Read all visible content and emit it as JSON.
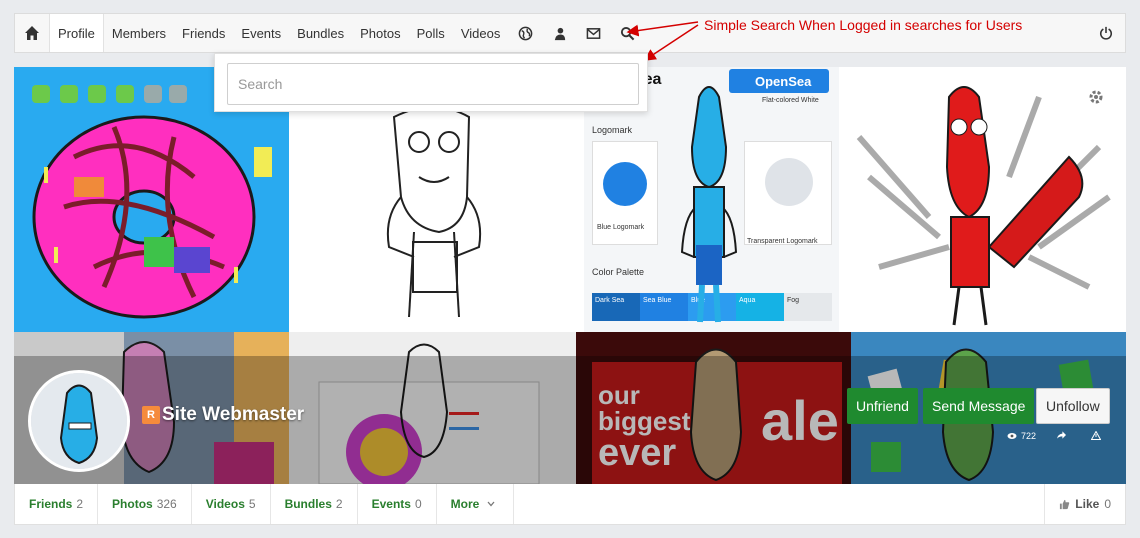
{
  "nav": {
    "items": [
      "Profile",
      "Members",
      "Friends",
      "Events",
      "Bundles",
      "Photos",
      "Polls",
      "Videos"
    ],
    "icons": [
      "home-icon",
      "globe-icon",
      "user-icon",
      "mail-icon",
      "search-icon",
      "power-icon"
    ]
  },
  "annotation": "Simple Search When Logged in searches for Users",
  "search": {
    "placeholder": "Search"
  },
  "cover": {
    "logos": {
      "brand_1": "OpenSea",
      "brand_2": "OpenSea"
    },
    "brand_page": {
      "flat_label": "Flat-colored White",
      "section_logomark": "Logomark",
      "blue_logomark": "Blue Logomark",
      "transparent_logomark": "Transparent Logomark",
      "color_palette": "Color Palette",
      "swatches": [
        "Dark Sea",
        "Sea Blue",
        "Blue",
        "Aqua",
        "Fog"
      ]
    },
    "sale_text": {
      "line1": "our",
      "line2": "biggest",
      "line3": "ever",
      "line4": "ale"
    }
  },
  "profile": {
    "name": "Site Webmaster",
    "rank_badge": "R",
    "views": "722"
  },
  "actions": {
    "unfriend": "Unfriend",
    "send_message": "Send Message",
    "unfollow": "Unfollow"
  },
  "tabs": [
    {
      "label": "Friends",
      "count": "2"
    },
    {
      "label": "Photos",
      "count": "326"
    },
    {
      "label": "Videos",
      "count": "5"
    },
    {
      "label": "Bundles",
      "count": "2"
    },
    {
      "label": "Events",
      "count": "0"
    },
    {
      "label": "More",
      "count": ""
    }
  ],
  "like": {
    "label": "Like",
    "count": "0"
  },
  "colors": {
    "green": "#1f8a2f",
    "annotation_red": "#d40000",
    "tab_green": "#2a7f2e"
  }
}
